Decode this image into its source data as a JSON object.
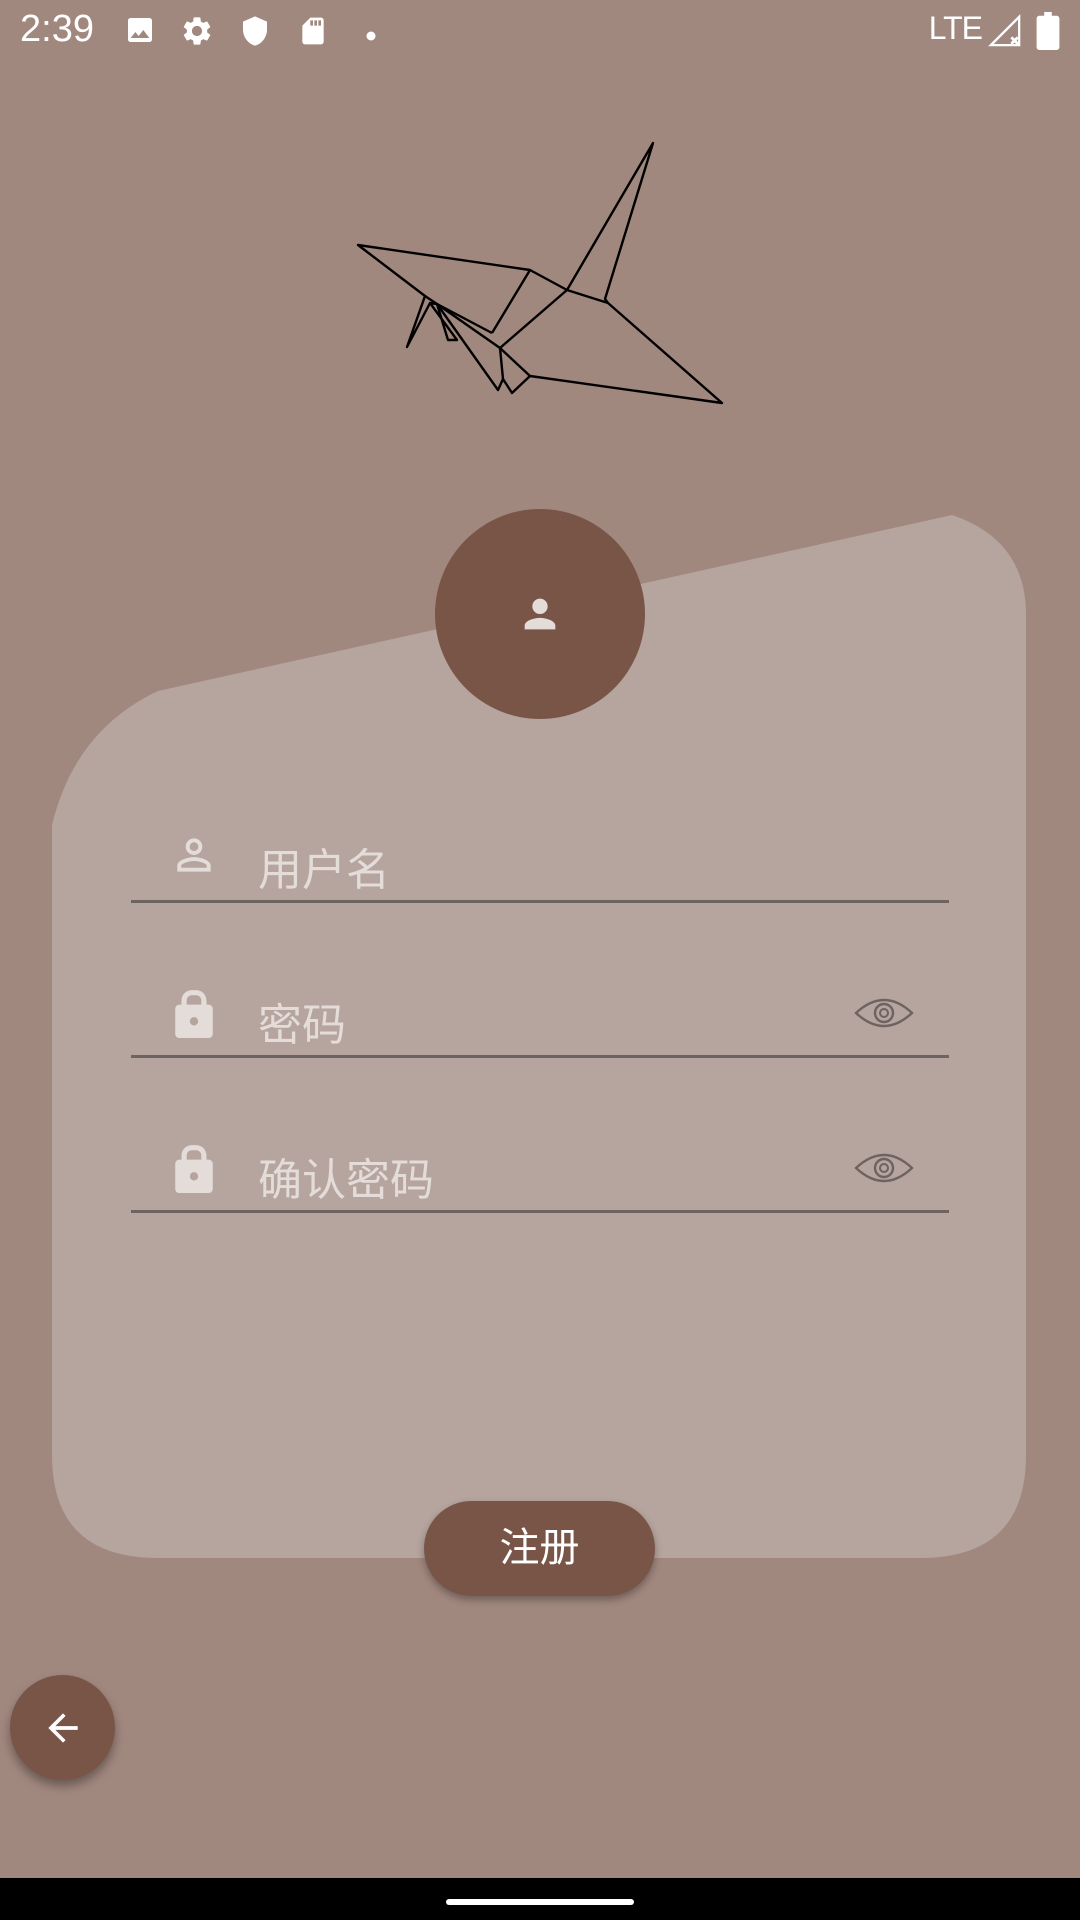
{
  "status_bar": {
    "time": "2:39",
    "network": "LTE",
    "icons": [
      "image-icon",
      "settings-icon",
      "shield-icon",
      "sd-card-icon",
      "dot-icon",
      "signal-icon",
      "battery-icon"
    ]
  },
  "form": {
    "username_placeholder": "用户名",
    "password_placeholder": "密码",
    "confirm_password_placeholder": "确认密码",
    "register_label": "注册"
  },
  "colors": {
    "background": "#a1887f",
    "card": "#b6a49e",
    "accent": "#795548"
  }
}
